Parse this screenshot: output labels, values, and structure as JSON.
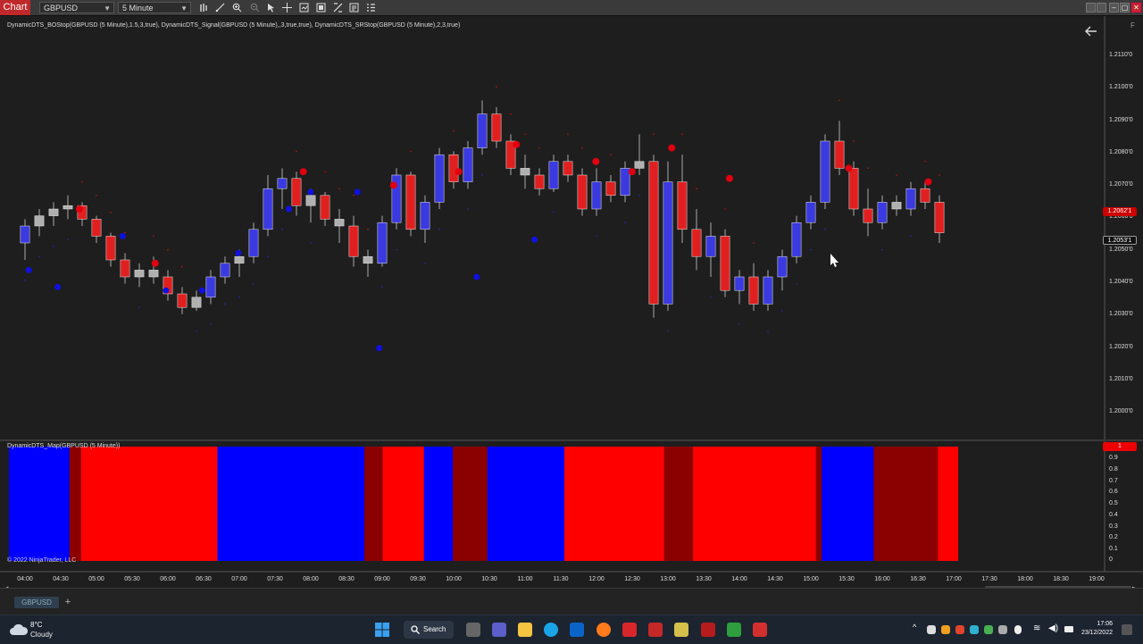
{
  "window": {
    "tab_label": "Chart",
    "instrument": "GBPUSD",
    "timeframe": "5 Minute",
    "close_box": "F"
  },
  "indicators": {
    "price_panel_label": "DynamicDTS_BOStop(GBPUSD (5 Minute),1.5,3,true), DynamicDTS_Signal(GBPUSD (5 Minute),,3,true,true), DynamicDTS_SRStop(GBPUSD (5 Minute),2,3,true)",
    "map_panel_label": "DynamicDTS_Map(GBPUSD (5 Minute))",
    "copyright": "© 2022 NinjaTrader, LLC"
  },
  "price_axis": {
    "labels": [
      "1.2110'0",
      "1.2100'0",
      "1.2090'0",
      "1.2080'0",
      "1.2070'0",
      "1.2060'0",
      "1.2050'0",
      "1.2040'0",
      "1.2030'0",
      "1.2020'0",
      "1.2010'0",
      "1.2000'0"
    ],
    "badge_red": "1.2062'1",
    "badge_last": "1.2053'1"
  },
  "map_axis": {
    "labels": [
      "0.9",
      "0.8",
      "0.7",
      "0.6",
      "0.5",
      "0.4",
      "0.3",
      "0.2",
      "0.1",
      "0"
    ],
    "badge": "1"
  },
  "time_axis": {
    "labels": [
      "04:00",
      "04:30",
      "05:00",
      "05:30",
      "06:00",
      "06:30",
      "07:00",
      "07:30",
      "08:00",
      "08:30",
      "09:00",
      "09:30",
      "10:00",
      "10:30",
      "11:00",
      "11:30",
      "12:00",
      "12:30",
      "13:00",
      "13:30",
      "14:00",
      "14:30",
      "15:00",
      "15:30",
      "16:00",
      "16:30",
      "17:00",
      "17:30",
      "18:00",
      "18:30",
      "19:00"
    ]
  },
  "bottom": {
    "instrument_tab": "GBPUSD",
    "add_tab": "+"
  },
  "taskbar": {
    "weather_temp": "8°C",
    "weather_condition": "Cloudy",
    "search_label": "Search",
    "time": "17:06",
    "date": "23/12/2022"
  },
  "colors": {
    "bull_candle": "#3a3ae0",
    "bear_candle": "#e02020",
    "neutral_candle": "#b0b0b0",
    "map_red": "#ff0000",
    "map_blue": "#0000ff",
    "map_dark_red": "#8b0000",
    "accent": "#c0292b"
  },
  "chart_data": {
    "type": "candlestick",
    "instrument": "GBPUSD",
    "interval": "5 Minute",
    "ylim": [
      1.1995,
      1.2115
    ],
    "candles": [
      {
        "o": 1.205,
        "h": 1.2057,
        "l": 1.2045,
        "c": 1.2055
      },
      {
        "o": 1.2055,
        "h": 1.206,
        "l": 1.2052,
        "c": 1.2058
      },
      {
        "o": 1.2058,
        "h": 1.2062,
        "l": 1.2055,
        "c": 1.206
      },
      {
        "o": 1.206,
        "h": 1.2064,
        "l": 1.2057,
        "c": 1.2061
      },
      {
        "o": 1.2061,
        "h": 1.2062,
        "l": 1.2055,
        "c": 1.2057
      },
      {
        "o": 1.2057,
        "h": 1.2058,
        "l": 1.205,
        "c": 1.2052
      },
      {
        "o": 1.2052,
        "h": 1.2053,
        "l": 1.2043,
        "c": 1.2045
      },
      {
        "o": 1.2045,
        "h": 1.2047,
        "l": 1.2038,
        "c": 1.204
      },
      {
        "o": 1.204,
        "h": 1.2044,
        "l": 1.2037,
        "c": 1.2042
      },
      {
        "o": 1.2042,
        "h": 1.2046,
        "l": 1.2038,
        "c": 1.204
      },
      {
        "o": 1.204,
        "h": 1.2042,
        "l": 1.2033,
        "c": 1.2035
      },
      {
        "o": 1.2035,
        "h": 1.2037,
        "l": 1.2029,
        "c": 1.2031
      },
      {
        "o": 1.2031,
        "h": 1.2036,
        "l": 1.203,
        "c": 1.2034
      },
      {
        "o": 1.2034,
        "h": 1.2042,
        "l": 1.2032,
        "c": 1.204
      },
      {
        "o": 1.204,
        "h": 1.2046,
        "l": 1.2038,
        "c": 1.2044
      },
      {
        "o": 1.2044,
        "h": 1.2048,
        "l": 1.204,
        "c": 1.2046
      },
      {
        "o": 1.2046,
        "h": 1.2056,
        "l": 1.2044,
        "c": 1.2054
      },
      {
        "o": 1.2054,
        "h": 1.207,
        "l": 1.2052,
        "c": 1.2066
      },
      {
        "o": 1.2066,
        "h": 1.2072,
        "l": 1.206,
        "c": 1.2069
      },
      {
        "o": 1.2069,
        "h": 1.2071,
        "l": 1.2058,
        "c": 1.2061
      },
      {
        "o": 1.2061,
        "h": 1.2066,
        "l": 1.2056,
        "c": 1.2064
      },
      {
        "o": 1.2064,
        "h": 1.2065,
        "l": 1.2055,
        "c": 1.2057
      },
      {
        "o": 1.2057,
        "h": 1.206,
        "l": 1.205,
        "c": 1.2055
      },
      {
        "o": 1.2055,
        "h": 1.2058,
        "l": 1.2043,
        "c": 1.2046
      },
      {
        "o": 1.2046,
        "h": 1.2048,
        "l": 1.204,
        "c": 1.2044
      },
      {
        "o": 1.2044,
        "h": 1.2058,
        "l": 1.2043,
        "c": 1.2056
      },
      {
        "o": 1.2056,
        "h": 1.2072,
        "l": 1.2054,
        "c": 1.207
      },
      {
        "o": 1.207,
        "h": 1.2071,
        "l": 1.2052,
        "c": 1.2054
      },
      {
        "o": 1.2054,
        "h": 1.2064,
        "l": 1.205,
        "c": 1.2062
      },
      {
        "o": 1.2062,
        "h": 1.2078,
        "l": 1.206,
        "c": 1.2076
      },
      {
        "o": 1.2076,
        "h": 1.2077,
        "l": 1.2066,
        "c": 1.2068
      },
      {
        "o": 1.2068,
        "h": 1.208,
        "l": 1.2066,
        "c": 1.2078
      },
      {
        "o": 1.2078,
        "h": 1.2092,
        "l": 1.2076,
        "c": 1.2088
      },
      {
        "o": 1.2088,
        "h": 1.209,
        "l": 1.2078,
        "c": 1.208
      },
      {
        "o": 1.208,
        "h": 1.2082,
        "l": 1.207,
        "c": 1.2072
      },
      {
        "o": 1.2072,
        "h": 1.2076,
        "l": 1.2066,
        "c": 1.207
      },
      {
        "o": 1.207,
        "h": 1.2072,
        "l": 1.2064,
        "c": 1.2066
      },
      {
        "o": 1.2066,
        "h": 1.2076,
        "l": 1.2065,
        "c": 1.2074
      },
      {
        "o": 1.2074,
        "h": 1.2076,
        "l": 1.2068,
        "c": 1.207
      },
      {
        "o": 1.207,
        "h": 1.2072,
        "l": 1.2058,
        "c": 1.206
      },
      {
        "o": 1.206,
        "h": 1.2072,
        "l": 1.2058,
        "c": 1.2068
      },
      {
        "o": 1.2068,
        "h": 1.207,
        "l": 1.2062,
        "c": 1.2064
      },
      {
        "o": 1.2064,
        "h": 1.2074,
        "l": 1.2062,
        "c": 1.2072
      },
      {
        "o": 1.2072,
        "h": 1.2082,
        "l": 1.207,
        "c": 1.2074
      },
      {
        "o": 1.2074,
        "h": 1.2076,
        "l": 1.2028,
        "c": 1.2032
      },
      {
        "o": 1.2032,
        "h": 1.2074,
        "l": 1.203,
        "c": 1.2068
      },
      {
        "o": 1.2068,
        "h": 1.2076,
        "l": 1.205,
        "c": 1.2054
      },
      {
        "o": 1.2054,
        "h": 1.206,
        "l": 1.2042,
        "c": 1.2046
      },
      {
        "o": 1.2046,
        "h": 1.2056,
        "l": 1.204,
        "c": 1.2052
      },
      {
        "o": 1.2052,
        "h": 1.2054,
        "l": 1.2034,
        "c": 1.2036
      },
      {
        "o": 1.2036,
        "h": 1.2042,
        "l": 1.2032,
        "c": 1.204
      },
      {
        "o": 1.204,
        "h": 1.2044,
        "l": 1.203,
        "c": 1.2032
      },
      {
        "o": 1.2032,
        "h": 1.2042,
        "l": 1.203,
        "c": 1.204
      },
      {
        "o": 1.204,
        "h": 1.2048,
        "l": 1.2036,
        "c": 1.2046
      },
      {
        "o": 1.2046,
        "h": 1.2058,
        "l": 1.2044,
        "c": 1.2056
      },
      {
        "o": 1.2056,
        "h": 1.2064,
        "l": 1.2054,
        "c": 1.2062
      },
      {
        "o": 1.2062,
        "h": 1.2082,
        "l": 1.206,
        "c": 1.208
      },
      {
        "o": 1.208,
        "h": 1.2086,
        "l": 1.207,
        "c": 1.2072
      },
      {
        "o": 1.2072,
        "h": 1.2074,
        "l": 1.2058,
        "c": 1.206
      },
      {
        "o": 1.206,
        "h": 1.2066,
        "l": 1.2052,
        "c": 1.2056
      },
      {
        "o": 1.2056,
        "h": 1.2064,
        "l": 1.2054,
        "c": 1.2062
      },
      {
        "o": 1.2062,
        "h": 1.2064,
        "l": 1.2058,
        "c": 1.206
      },
      {
        "o": 1.206,
        "h": 1.2068,
        "l": 1.2058,
        "c": 1.2066
      },
      {
        "o": 1.2066,
        "h": 1.2068,
        "l": 1.206,
        "c": 1.2062
      },
      {
        "o": 1.2062,
        "h": 1.2064,
        "l": 1.205,
        "c": 1.2053
      }
    ],
    "signal_buy": [
      [
        5,
        1.2042
      ],
      [
        13,
        1.2037
      ],
      [
        31,
        1.2052
      ],
      [
        43,
        1.2036
      ],
      [
        53,
        1.2036
      ],
      [
        63,
        1.2047
      ],
      [
        77,
        1.206
      ],
      [
        83,
        1.2065
      ],
      [
        96,
        1.2065
      ],
      [
        102,
        1.2019
      ],
      [
        129,
        1.204
      ],
      [
        145,
        1.2051
      ]
    ],
    "signal_sell": [
      [
        19,
        1.206
      ],
      [
        40,
        1.2044
      ],
      [
        81,
        1.2071
      ],
      [
        106,
        1.2067
      ],
      [
        124,
        1.2071
      ],
      [
        140,
        1.2079
      ],
      [
        162,
        1.2074
      ],
      [
        172,
        1.2071
      ],
      [
        183,
        1.2078
      ],
      [
        199,
        1.2069
      ],
      [
        232,
        1.2072
      ],
      [
        254,
        1.2068
      ]
    ],
    "map": [
      {
        "color": "blue",
        "start": 0,
        "end": 0.063
      },
      {
        "color": "dark_red",
        "start": 0.063,
        "end": 0.075
      },
      {
        "color": "red",
        "start": 0.075,
        "end": 0.217
      },
      {
        "color": "blue",
        "start": 0.217,
        "end": 0.37
      },
      {
        "color": "dark_red",
        "start": 0.37,
        "end": 0.389
      },
      {
        "color": "red",
        "start": 0.389,
        "end": 0.432
      },
      {
        "color": "blue",
        "start": 0.432,
        "end": 0.462
      },
      {
        "color": "dark_red",
        "start": 0.462,
        "end": 0.498
      },
      {
        "color": "blue",
        "start": 0.498,
        "end": 0.578
      },
      {
        "color": "red",
        "start": 0.578,
        "end": 0.682
      },
      {
        "color": "dark_red",
        "start": 0.682,
        "end": 0.712
      },
      {
        "color": "red",
        "start": 0.712,
        "end": 0.84
      },
      {
        "color": "dark_red",
        "start": 0.84,
        "end": 0.846
      },
      {
        "color": "blue",
        "start": 0.846,
        "end": 0.9
      },
      {
        "color": "dark_red",
        "start": 0.9,
        "end": 0.967
      },
      {
        "color": "red",
        "start": 0.967,
        "end": 0.988
      }
    ]
  }
}
